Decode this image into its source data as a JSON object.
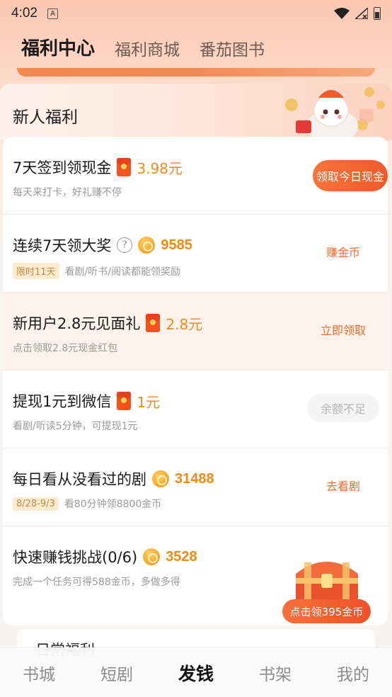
{
  "status_bar": {
    "time": "4:02",
    "notification_icon": "A"
  },
  "top_tabs": [
    {
      "label": "福利中心",
      "active": true
    },
    {
      "label": "福利商城",
      "active": false
    },
    {
      "label": "番茄图书",
      "active": false
    }
  ],
  "section": {
    "title": "新人福利"
  },
  "tasks": [
    {
      "title": "7天签到领现金",
      "reward_icon": "red-envelope-icon",
      "reward": "3.98元",
      "subtitle": "每天来打卡，好礼赚不停",
      "action": "领取今日现金",
      "action_style": "filled"
    },
    {
      "title": "连续7天领大奖",
      "reward_icon": "coin-icon",
      "reward": "9585",
      "tag": "限时11天",
      "subtitle": "看剧/听书/阅读都能领奖励",
      "action": "赚金币",
      "action_style": "text"
    },
    {
      "title": "新用户2.8元见面礼",
      "reward_icon": "red-envelope-icon",
      "reward": "2.8元",
      "subtitle": "点击领取2.8元现金红包",
      "action": "立即领取",
      "action_style": "text"
    },
    {
      "title": "提现1元到微信",
      "reward_icon": "red-envelope-icon",
      "reward": "1元",
      "subtitle": "看剧/听读5分钟，可提现1元",
      "action": "余额不足",
      "action_style": "disabled"
    },
    {
      "title": "每日看从没看过的剧",
      "reward_icon": "coin-icon",
      "reward": "31488",
      "tag": "8/28-9/3",
      "subtitle": "看80分钟领8800金币",
      "action": "去看剧",
      "action_style": "text"
    },
    {
      "title": "快速赚钱挑战(0/6)",
      "reward_icon": "coin-icon",
      "reward": "3528",
      "subtitle": "完成一个任务可得588金币，多做多得",
      "action": "点击领395金币",
      "action_style": "chest"
    }
  ],
  "next_section_title": "日常福利",
  "bottom_nav": [
    {
      "label": "书城",
      "active": false
    },
    {
      "label": "短剧",
      "active": false
    },
    {
      "label": "发钱",
      "active": true
    },
    {
      "label": "书架",
      "active": false
    },
    {
      "label": "我的",
      "active": false
    }
  ],
  "colors": {
    "accent": "#f26a2e",
    "reward": "#f28a12",
    "header_gradient_top": "#fbc7b1"
  }
}
